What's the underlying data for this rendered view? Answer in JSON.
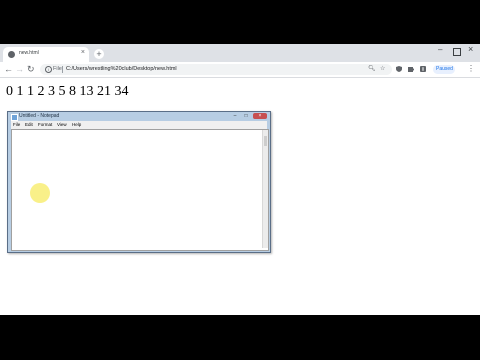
{
  "browser": {
    "tab_title": "new.html",
    "new_tab_symbol": "+",
    "close_symbol": "×",
    "scheme_label": "File",
    "url": "C:/Users/wrestling%20club/Desktop/new.html",
    "paused_label": "Paused"
  },
  "page": {
    "fibonacci_text": "0 1 1 2 3 5 8 13 21 34"
  },
  "notepad": {
    "title": "Untitled - Notepad",
    "menus": [
      "File",
      "Edit",
      "Format",
      "View",
      "Help"
    ],
    "text": ""
  },
  "colors": {
    "tabstrip": "#dee1e6",
    "notepad_frame": "#b7cde3",
    "cursor_highlight": "#f8ee7c"
  }
}
